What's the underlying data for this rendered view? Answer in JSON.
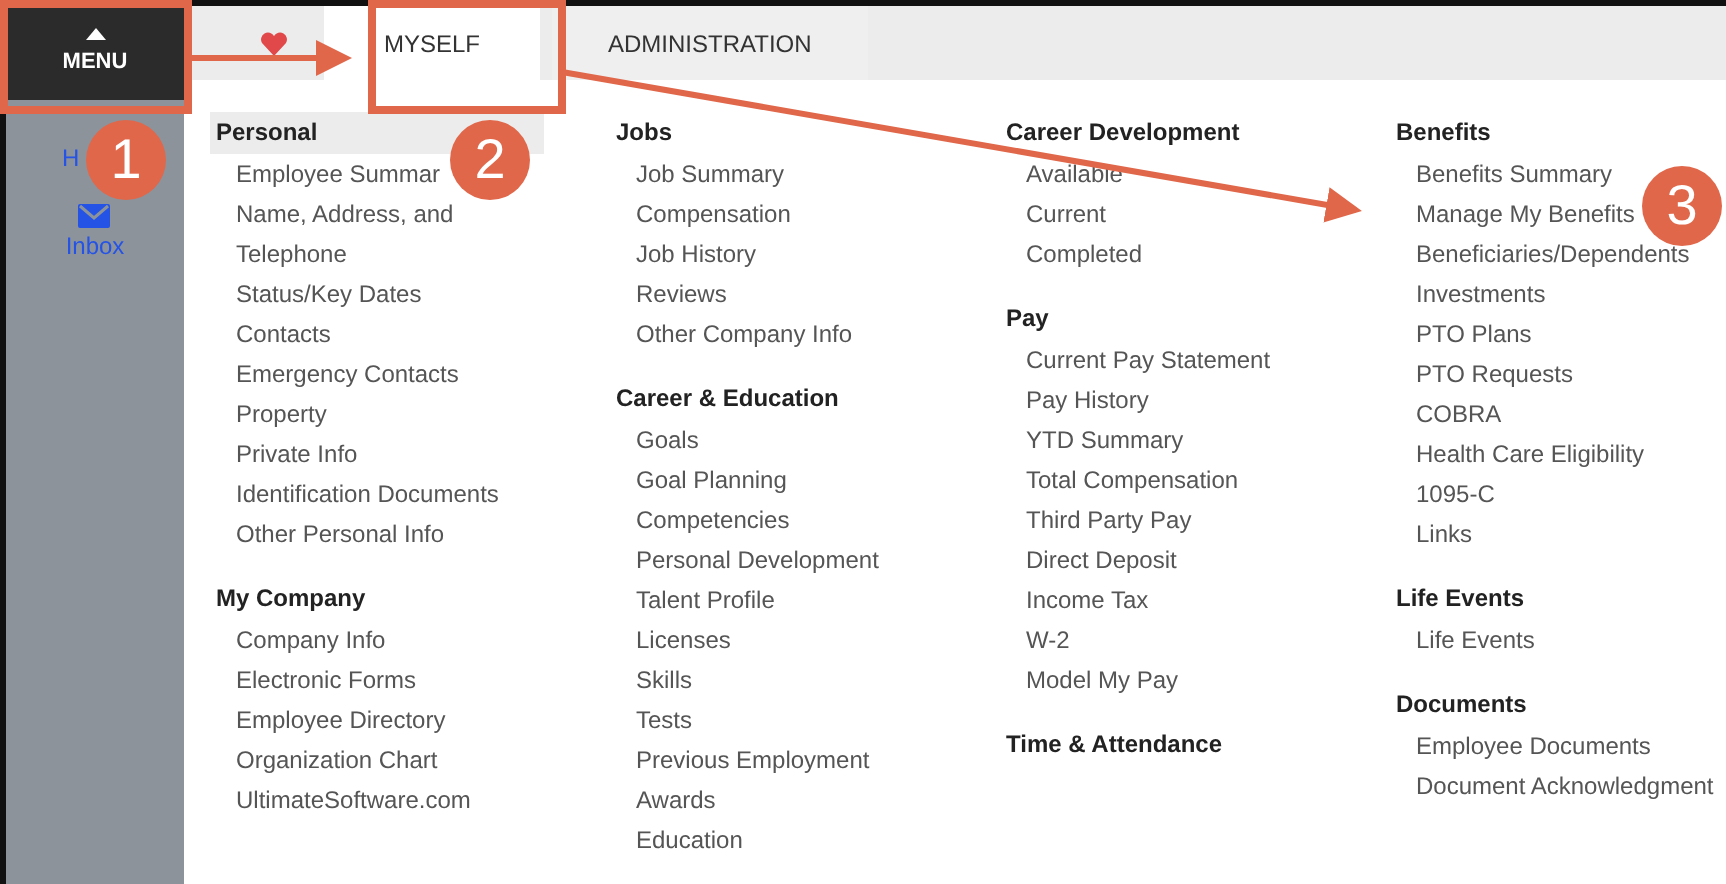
{
  "menu_button": {
    "label": "MENU"
  },
  "sidebar": {
    "items": [
      {
        "label": "H",
        "kind": "home"
      },
      {
        "label": "Inbox",
        "kind": "inbox"
      }
    ]
  },
  "tabs": [
    {
      "kind": "favorites",
      "selected": false
    },
    {
      "label": "MYSELF",
      "selected": true
    },
    {
      "label": "ADMINISTRATION",
      "selected": false
    }
  ],
  "columns": [
    {
      "groups": [
        {
          "heading": "Personal",
          "selected": true,
          "items": [
            "Employee Summar",
            "Name, Address, and Telephone",
            "Status/Key Dates",
            "Contacts",
            "Emergency Contacts",
            "Property",
            "Private Info",
            "Identification Documents",
            "Other Personal Info"
          ]
        },
        {
          "heading": "My Company",
          "selected": false,
          "items": [
            "Company Info",
            "Electronic Forms",
            "Employee Directory",
            "Organization Chart",
            "UltimateSoftware.com"
          ]
        }
      ]
    },
    {
      "groups": [
        {
          "heading": "Jobs",
          "selected": false,
          "items": [
            "Job Summary",
            "Compensation",
            "Job History",
            "Reviews",
            "Other Company Info"
          ]
        },
        {
          "heading": "Career & Education",
          "selected": false,
          "items": [
            "Goals",
            "Goal Planning",
            "Competencies",
            "Personal Development",
            "Talent Profile",
            "Licenses",
            "Skills",
            "Tests",
            "Previous Employment",
            "Awards",
            "Education"
          ]
        }
      ]
    },
    {
      "groups": [
        {
          "heading": "Career Development",
          "selected": false,
          "items": [
            "Available",
            "Current",
            "Completed"
          ]
        },
        {
          "heading": "Pay",
          "selected": false,
          "items": [
            "Current Pay Statement",
            "Pay History",
            "YTD Summary",
            "Total Compensation",
            "Third Party Pay",
            "Direct Deposit",
            "Income Tax",
            "W-2",
            "Model My Pay"
          ]
        },
        {
          "heading": "Time & Attendance",
          "selected": false
        }
      ]
    },
    {
      "groups": [
        {
          "heading": "Benefits",
          "selected": false,
          "items": [
            "Benefits Summary",
            "Manage My Benefits",
            "Beneficiaries/Dependents",
            "Investments",
            "PTO Plans",
            "PTO Requests",
            "COBRA",
            "Health Care Eligibility",
            "1095-C",
            "Links"
          ]
        },
        {
          "heading": "Life Events",
          "selected": false,
          "items": [
            "Life Events"
          ]
        },
        {
          "heading": "Documents",
          "selected": false,
          "items": [
            "Employee Documents",
            "Document Acknowledgment"
          ]
        }
      ]
    }
  ],
  "annotations": {
    "callouts": [
      {
        "label": "1"
      },
      {
        "label": "2"
      },
      {
        "label": "3"
      }
    ]
  }
}
